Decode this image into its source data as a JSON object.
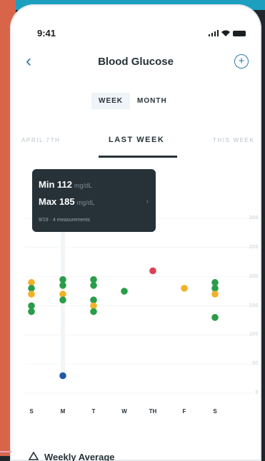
{
  "status_bar": {
    "time": "9:41"
  },
  "header": {
    "title": "Blood Glucose",
    "back_icon": "chevron-left-icon",
    "add_icon": "plus-circle-icon"
  },
  "view_toggle": {
    "options": [
      "WEEK",
      "MONTH"
    ],
    "selected": "WEEK"
  },
  "period_nav": {
    "previous": "APRIL 7TH",
    "current": "LAST WEEK",
    "next": "THIS WEEK"
  },
  "tooltip": {
    "min_label": "Min 112",
    "max_label": "Max 185",
    "unit": "mg/dL",
    "detail": "9/19 · 4 measurements"
  },
  "chart_data": {
    "type": "scatter",
    "categories": [
      "S",
      "M",
      "T",
      "W",
      "TH",
      "F",
      "S"
    ],
    "y_axis_ticks": [
      "300",
      "250",
      "200",
      "150",
      "100",
      "50",
      "0"
    ],
    "colors": {
      "in_range": "#2a9d4a",
      "elevated": "#f2b227",
      "low": "#1f5aa8",
      "high": "#d94355"
    },
    "points": [
      {
        "day": "S",
        "values": [
          190,
          180,
          170,
          150,
          140
        ],
        "status": [
          "elevated",
          "in_range",
          "elevated",
          "in_range",
          "in_range"
        ]
      },
      {
        "day": "M",
        "values": [
          195,
          185,
          170,
          160,
          30
        ],
        "status": [
          "in_range",
          "in_range",
          "elevated",
          "in_range",
          "low"
        ]
      },
      {
        "day": "T",
        "values": [
          195,
          185,
          160,
          150,
          140
        ],
        "status": [
          "in_range",
          "in_range",
          "in_range",
          "elevated",
          "in_range"
        ]
      },
      {
        "day": "W",
        "values": [
          175
        ],
        "status": [
          "in_range"
        ]
      },
      {
        "day": "TH",
        "values": [
          210
        ],
        "status": [
          "high"
        ]
      },
      {
        "day": "F",
        "values": [
          180
        ],
        "status": [
          "elevated"
        ]
      },
      {
        "day": "S",
        "values": [
          190,
          180,
          170,
          130
        ],
        "status": [
          "in_range",
          "in_range",
          "elevated",
          "in_range"
        ]
      }
    ]
  },
  "summary": {
    "label": "Weekly Average"
  }
}
